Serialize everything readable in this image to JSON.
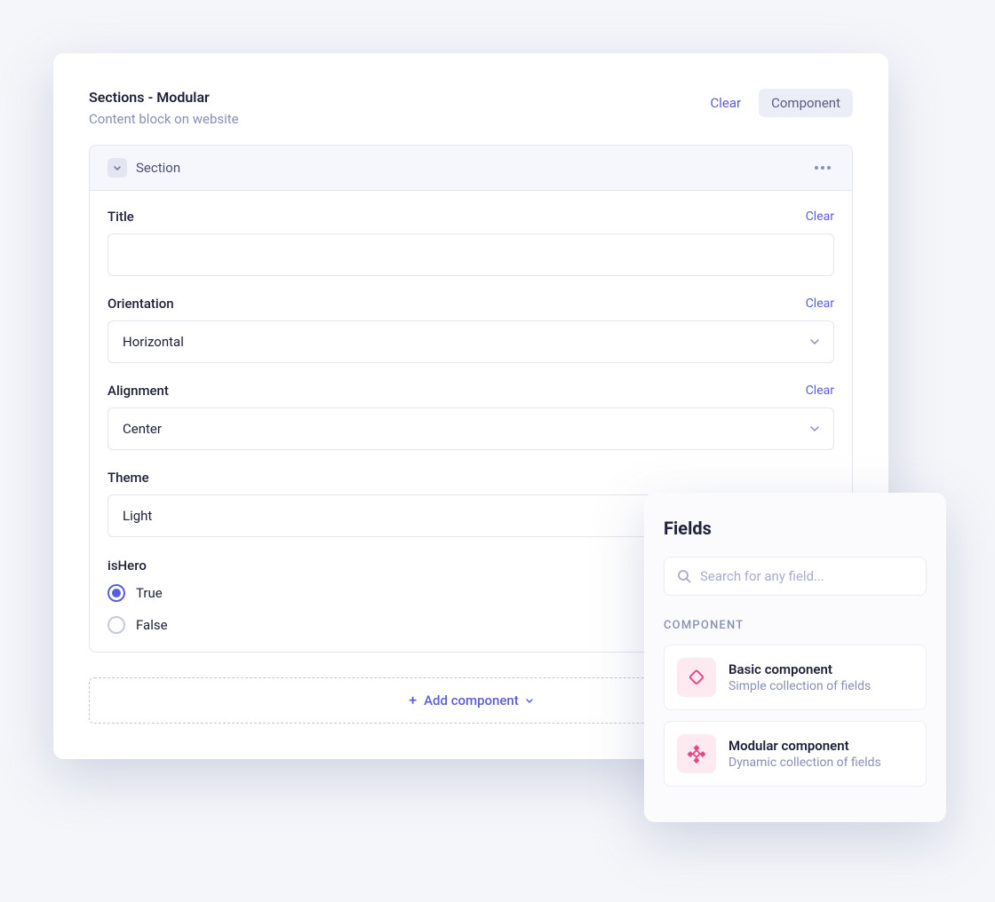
{
  "header": {
    "title": "Sections - Modular",
    "subtitle": "Content block on website",
    "clear_label": "Clear",
    "badge_label": "Component"
  },
  "section": {
    "header_title": "Section",
    "fields": {
      "title": {
        "label": "Title",
        "clear": "Clear",
        "value": ""
      },
      "orientation": {
        "label": "Orientation",
        "clear": "Clear",
        "value": "Horizontal"
      },
      "alignment": {
        "label": "Alignment",
        "clear": "Clear",
        "value": "Center"
      },
      "theme": {
        "label": "Theme",
        "value": "Light"
      },
      "isHero": {
        "label": "isHero",
        "options": {
          "true": "True",
          "false": "False"
        },
        "selected": "true"
      }
    }
  },
  "add_component_label": "Add component",
  "fields_popup": {
    "title": "Fields",
    "search_placeholder": "Search for any field...",
    "group_label": "COMPONENT",
    "items": [
      {
        "title": "Basic component",
        "desc": "Simple collection of fields"
      },
      {
        "title": "Modular component",
        "desc": "Dynamic collection of fields"
      }
    ]
  },
  "colors": {
    "accent": "#5b5edb",
    "pink": "#e54886"
  }
}
